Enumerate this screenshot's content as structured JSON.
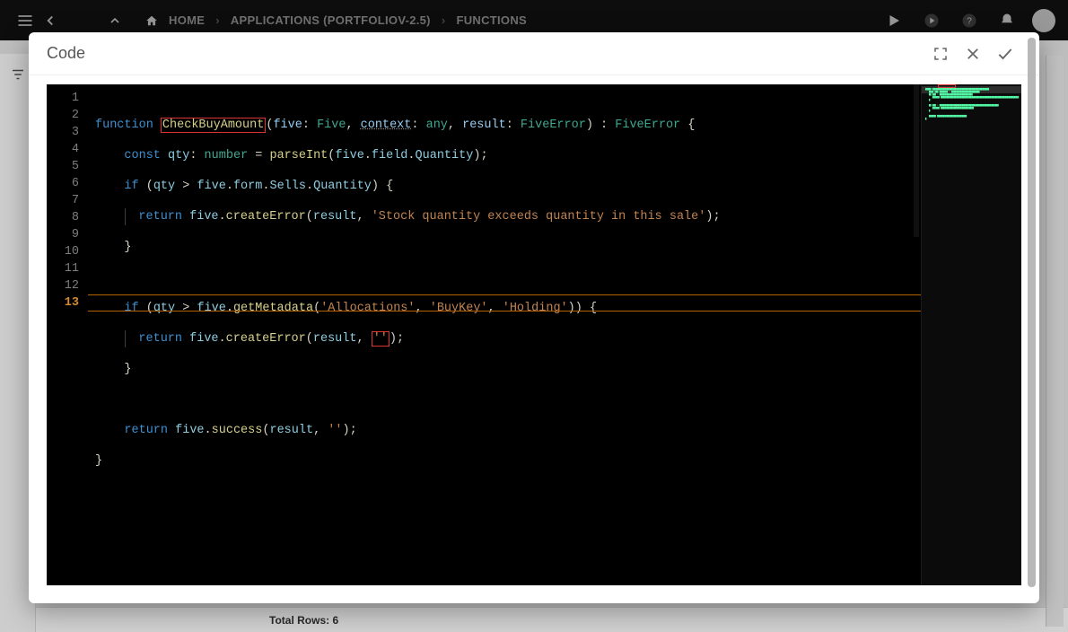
{
  "topbar": {
    "home_label": "HOME",
    "breadcrumb1": "APPLICATIONS (PORTFOLIOV-2.5)",
    "breadcrumb2": "FUNCTIONS"
  },
  "statusbar": {
    "text": "Total Rows: 6"
  },
  "modal": {
    "title": "Code"
  },
  "code": {
    "lines": [
      "1",
      "2",
      "3",
      "4",
      "5",
      "6",
      "7",
      "8",
      "9",
      "10",
      "11",
      "12",
      "13"
    ],
    "fn_keyword": "function",
    "fn_name": "CheckBuyAmount",
    "param_five": "five",
    "type_five": "Five",
    "param_context": "context",
    "type_any": "any",
    "param_result": "result",
    "type_fiveerror": "FiveError",
    "const_kw": "const",
    "qty": "qty",
    "number_type": "number",
    "parseInt": "parseInt",
    "field": "field",
    "Quantity": "Quantity",
    "if_kw": "if",
    "form": "form",
    "Sells": "Sells",
    "return_kw": "return",
    "createError": "createError",
    "err1": "'Stock quantity exceeds quantity in this sale'",
    "getMetadata": "getMetadata",
    "alloc": "'Allocations'",
    "buykey": "'BuyKey'",
    "holding": "'Holding'",
    "emptystr": "''",
    "success": "success"
  }
}
